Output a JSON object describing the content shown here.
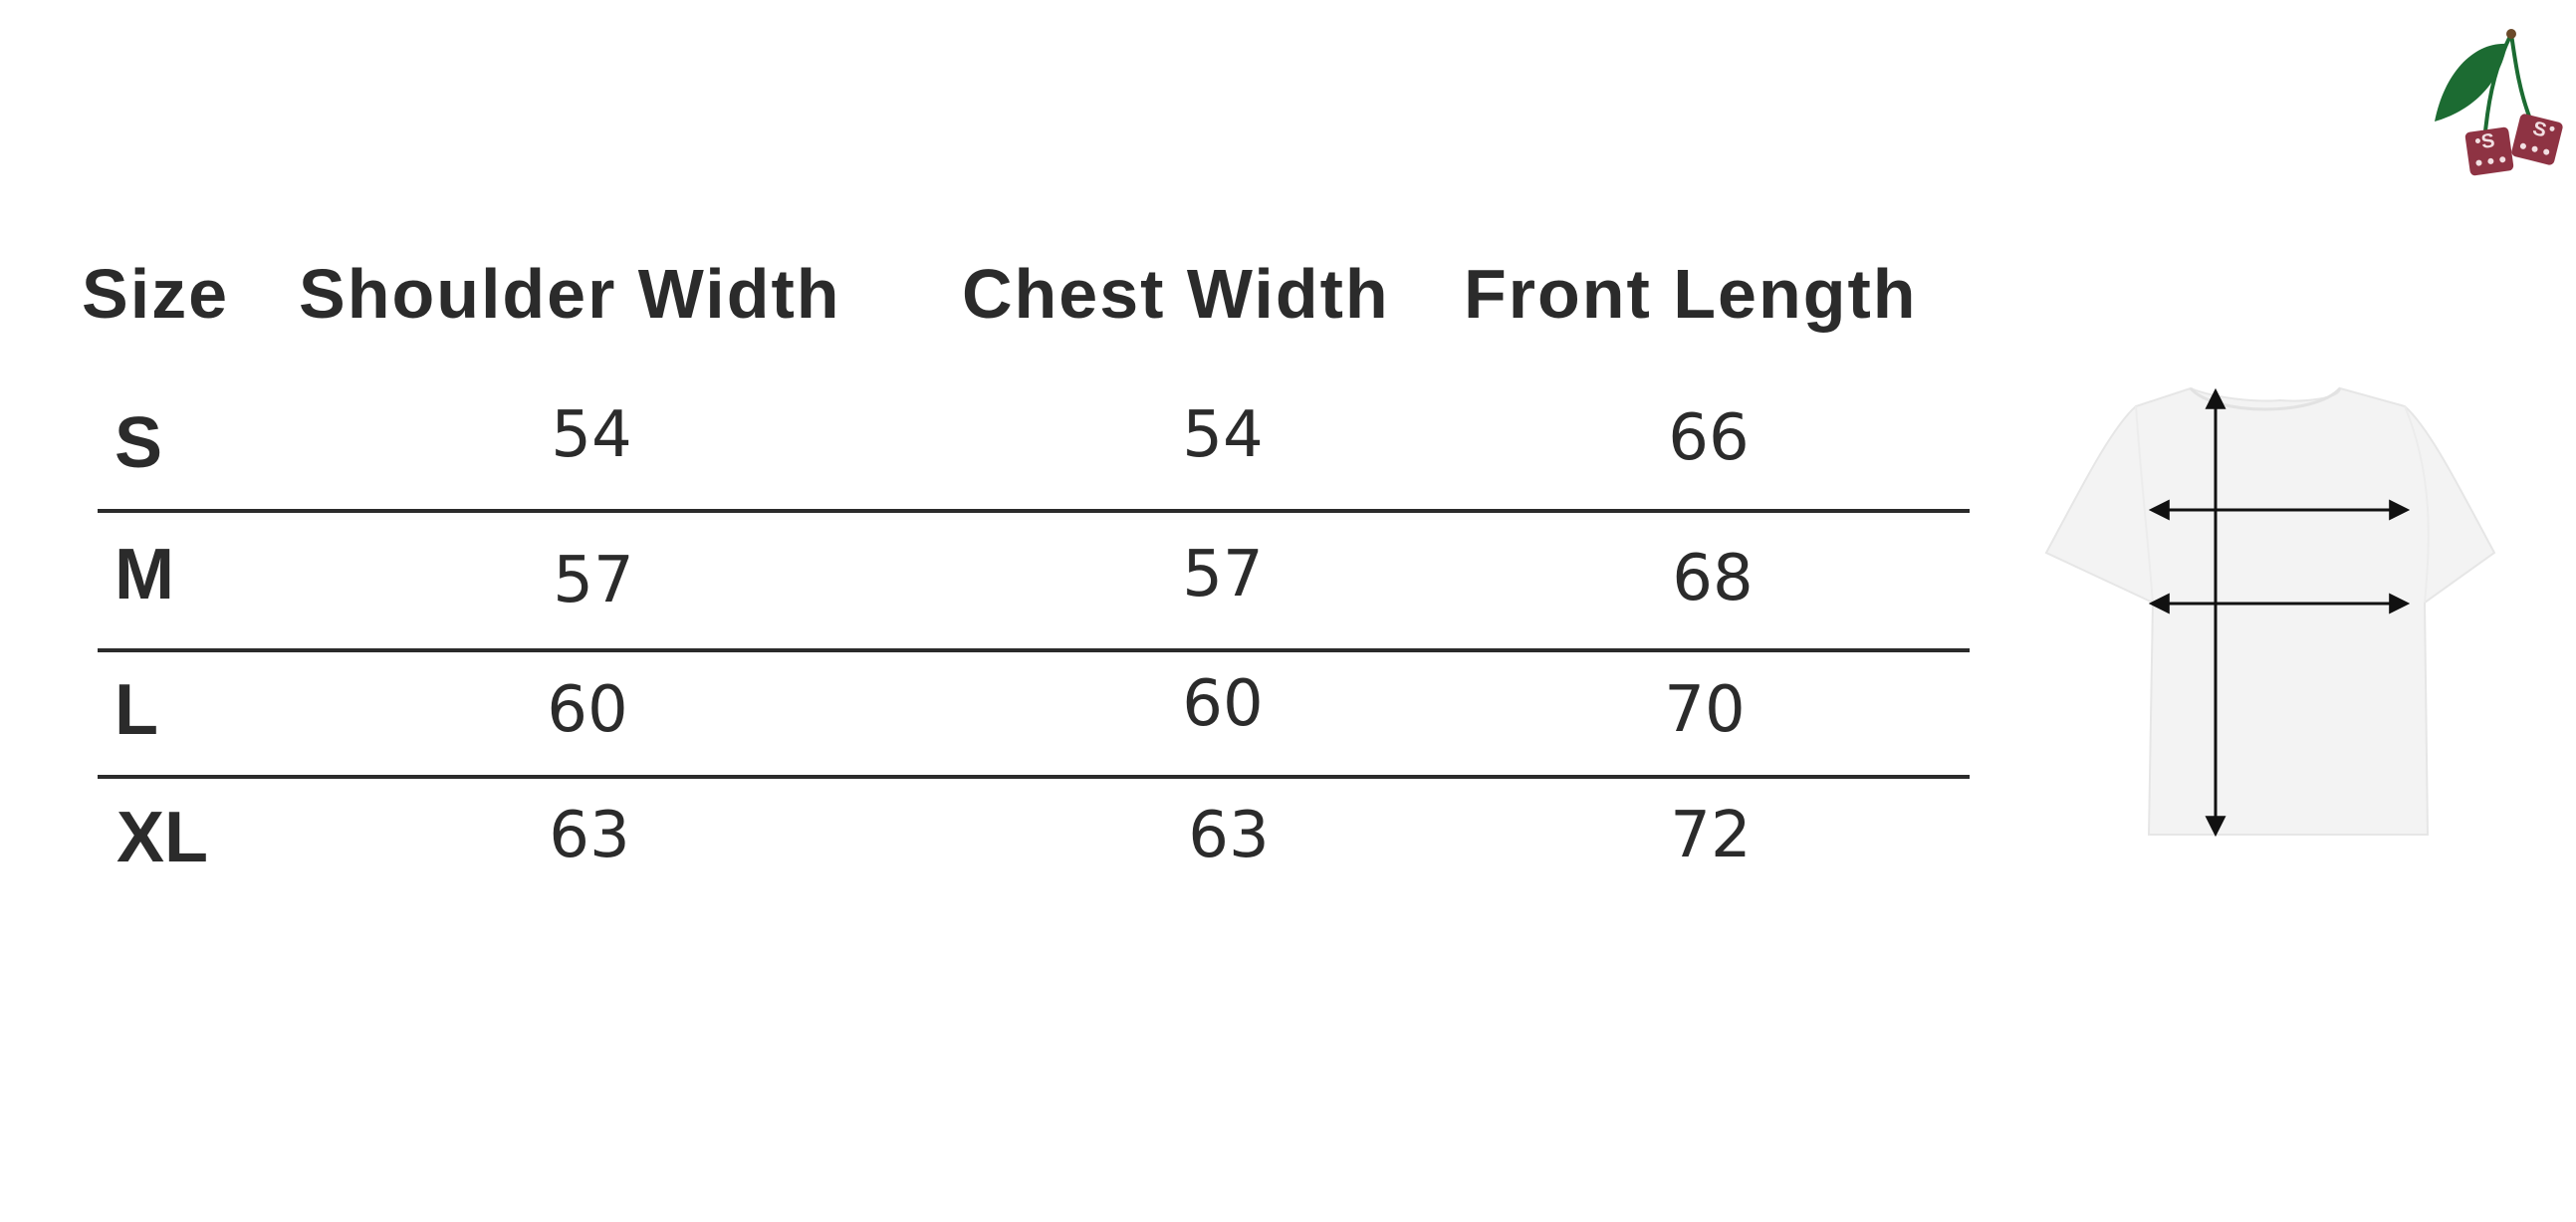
{
  "table": {
    "headers": {
      "size": "Size",
      "shoulder": "Shoulder Width",
      "chest": "Chest Width",
      "length": "Front Length"
    },
    "rows": [
      {
        "size": "S",
        "shoulder": "54",
        "chest": "54",
        "length": "66"
      },
      {
        "size": "M",
        "shoulder": "57",
        "chest": "57",
        "length": "68"
      },
      {
        "size": "L",
        "shoulder": "60",
        "chest": "60",
        "length": "70"
      },
      {
        "size": "XL",
        "shoulder": "63",
        "chest": "63",
        "length": "72"
      }
    ]
  },
  "logo": {
    "icon": "cherry-dice-logo-icon",
    "dice_letter": "S",
    "leaf_color": "#1c6b32",
    "dice_color": "#8e3343"
  },
  "diagram": {
    "icon": "tshirt-measurement-icon",
    "shirt_color": "#f3f3f3",
    "arrow_color": "#111111"
  }
}
